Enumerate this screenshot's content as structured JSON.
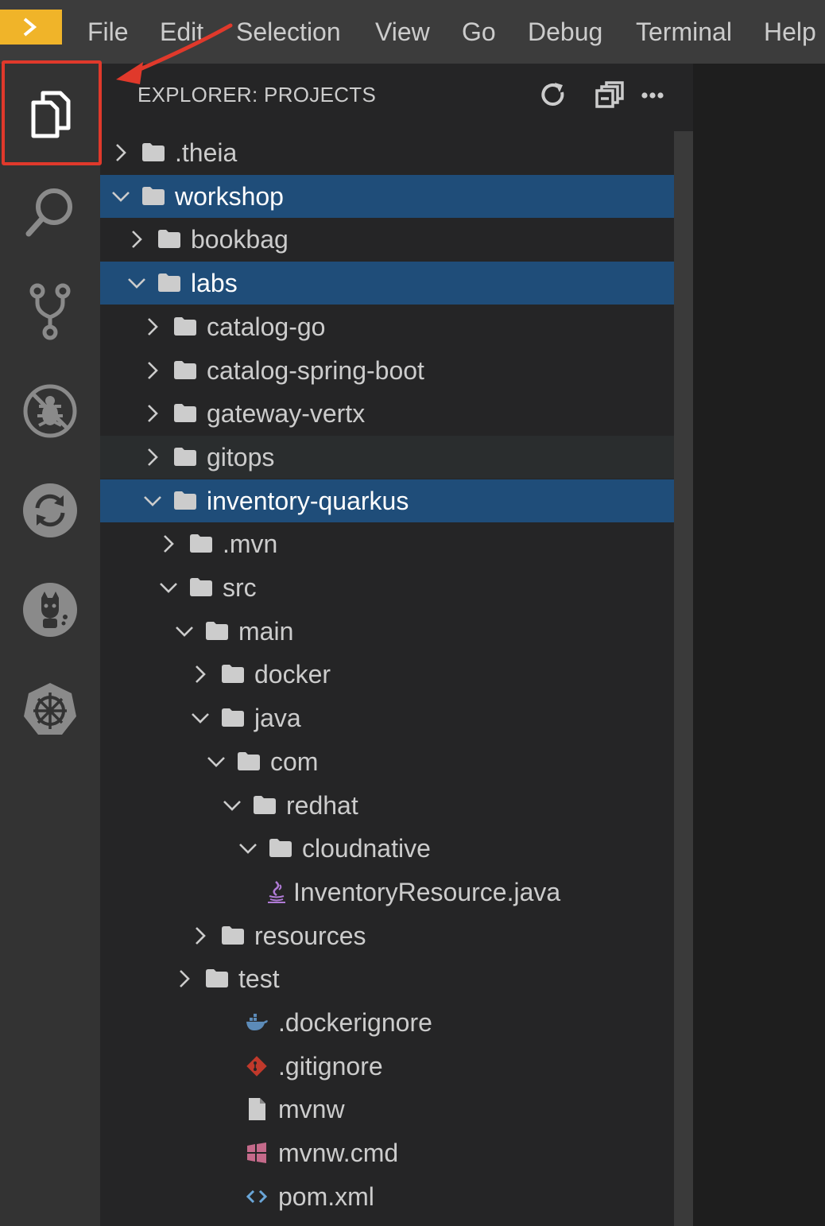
{
  "menu": [
    "File",
    "Edit",
    "Selection",
    "View",
    "Go",
    "Debug",
    "Terminal",
    "Help"
  ],
  "activity_bar": [
    {
      "name": "explorer-icon"
    },
    {
      "name": "search-icon"
    },
    {
      "name": "source-control-icon"
    },
    {
      "name": "debug-icon"
    },
    {
      "name": "sync-icon"
    },
    {
      "name": "plugins-icon"
    },
    {
      "name": "kubernetes-icon"
    }
  ],
  "explorer": {
    "title": "EXPLORER: PROJECTS",
    "actions": [
      "refresh-icon",
      "collapse-all-icon",
      "more-icon"
    ],
    "tree": [
      {
        "label": ".theia",
        "depth": 0,
        "type": "folder",
        "expanded": false,
        "state": ""
      },
      {
        "label": "workshop",
        "depth": 0,
        "type": "folder",
        "expanded": true,
        "state": "selected"
      },
      {
        "label": "bookbag",
        "depth": 1,
        "type": "folder",
        "expanded": false,
        "state": ""
      },
      {
        "label": "labs",
        "depth": 1,
        "type": "folder",
        "expanded": true,
        "state": "selected"
      },
      {
        "label": "catalog-go",
        "depth": 2,
        "type": "folder",
        "expanded": false,
        "state": ""
      },
      {
        "label": "catalog-spring-boot",
        "depth": 2,
        "type": "folder",
        "expanded": false,
        "state": ""
      },
      {
        "label": "gateway-vertx",
        "depth": 2,
        "type": "folder",
        "expanded": false,
        "state": ""
      },
      {
        "label": "gitops",
        "depth": 2,
        "type": "folder",
        "expanded": false,
        "state": "hover"
      },
      {
        "label": "inventory-quarkus",
        "depth": 2,
        "type": "folder",
        "expanded": true,
        "state": "selected"
      },
      {
        "label": ".mvn",
        "depth": 3,
        "type": "folder",
        "expanded": false,
        "state": ""
      },
      {
        "label": "src",
        "depth": 3,
        "type": "folder",
        "expanded": true,
        "state": ""
      },
      {
        "label": "main",
        "depth": 4,
        "type": "folder",
        "expanded": true,
        "state": ""
      },
      {
        "label": "docker",
        "depth": 5,
        "type": "folder",
        "expanded": false,
        "state": ""
      },
      {
        "label": "java",
        "depth": 5,
        "type": "folder",
        "expanded": true,
        "state": ""
      },
      {
        "label": "com",
        "depth": 6,
        "type": "folder",
        "expanded": true,
        "state": ""
      },
      {
        "label": "redhat",
        "depth": 7,
        "type": "folder",
        "expanded": true,
        "state": ""
      },
      {
        "label": "cloudnative",
        "depth": 8,
        "type": "folder",
        "expanded": true,
        "state": ""
      },
      {
        "label": "InventoryResource.java",
        "depth": 9,
        "type": "java",
        "state": ""
      },
      {
        "label": "resources",
        "depth": 5,
        "type": "folder",
        "expanded": false,
        "state": ""
      },
      {
        "label": "test",
        "depth": 4,
        "type": "folder",
        "expanded": false,
        "state": ""
      },
      {
        "label": ".dockerignore",
        "depth": 4,
        "type": "docker",
        "state": ""
      },
      {
        "label": ".gitignore",
        "depth": 4,
        "type": "git",
        "state": ""
      },
      {
        "label": "mvnw",
        "depth": 4,
        "type": "file",
        "state": ""
      },
      {
        "label": "mvnw.cmd",
        "depth": 4,
        "type": "windows",
        "state": ""
      },
      {
        "label": "pom.xml",
        "depth": 4,
        "type": "xml",
        "state": ""
      }
    ]
  },
  "colors": {
    "accent": "#f0b429",
    "selection": "#1f4d79",
    "annotation": "#e0392b"
  }
}
